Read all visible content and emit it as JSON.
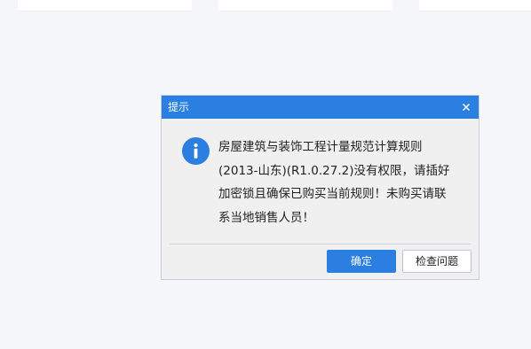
{
  "dialog": {
    "title": "提示",
    "message_lines": [
      "房屋建筑与装饰工程计量规范计算规则",
      "(2013-山东)(R1.0.27.2)没有权限，请插好",
      "加密锁且确保已购买当前规则！未购买请联",
      "系当地销售人员！"
    ],
    "confirm_label": "确定",
    "check_issue_label": "检查问题",
    "icons": {
      "close": "close-icon",
      "info": "info-icon"
    }
  },
  "colors": {
    "accent": "#2a7fe0",
    "dialog_bg": "#f0f0f0",
    "page_bg": "#f5f6fa"
  }
}
